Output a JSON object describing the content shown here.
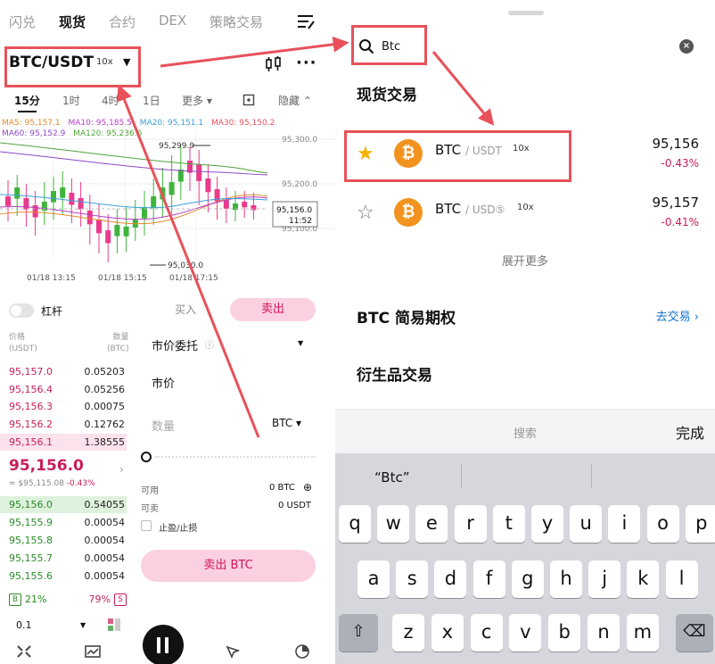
{
  "left": {
    "top_tabs": [
      "闪兑",
      "现货",
      "合约",
      "DEX",
      "策略交易"
    ],
    "active_tab": "现货",
    "pair": {
      "name": "BTC/USDT",
      "leverage": "10x"
    },
    "timeframes": [
      "15分",
      "1时",
      "4时",
      "1日",
      "更多 ▾",
      "隐藏 ⌃"
    ],
    "active_timeframe": "15分",
    "ma_line1": [
      {
        "label": "MA5: 95,157.1",
        "color": "#e58a2a"
      },
      {
        "label": "MA10: 95,185.5",
        "color": "#b43ec0"
      },
      {
        "label": "MA20: 95,151.1",
        "color": "#3aa0d8"
      },
      {
        "label": "MA30: 95,150.2",
        "color": "#e8515a"
      }
    ],
    "ma_line2": [
      {
        "label": "MA60: 95,152.9",
        "color": "#8e47c6"
      },
      {
        "label": "MA120: 95,236.6",
        "color": "#50a23a"
      }
    ],
    "chart": {
      "price_axis": [
        "95,300.0",
        "95,200.0",
        "95,100.0"
      ],
      "current_price_tag": "95,156.0",
      "countdown": "11:52",
      "high_label": "95,299.9",
      "low_label": "95,030.0",
      "time_axis": [
        "01/18 13:15",
        "01/18 15:15",
        "01/18 17:15"
      ]
    },
    "leverage_label": "杠杆",
    "buy_label": "买入",
    "sell_label": "卖出",
    "orderbook": {
      "price_header": [
        "价格",
        "(USDT)"
      ],
      "qty_header": [
        "数量",
        "(BTC)"
      ],
      "asks": [
        {
          "price": "95,157.0",
          "qty": "0.05203"
        },
        {
          "price": "95,156.4",
          "qty": "0.05256"
        },
        {
          "price": "95,156.3",
          "qty": "0.00075"
        },
        {
          "price": "95,156.2",
          "qty": "0.12762"
        },
        {
          "price": "95,156.1",
          "qty": "1.38555"
        }
      ],
      "last_price": "95,156.0",
      "last_sub": "≈ $95,115.08",
      "last_change": "-0.43%",
      "bids": [
        {
          "price": "95,156.0",
          "qty": "0.54055"
        },
        {
          "price": "95,155.9",
          "qty": "0.00054"
        },
        {
          "price": "95,155.8",
          "qty": "0.00054"
        },
        {
          "price": "95,155.7",
          "qty": "0.00054"
        },
        {
          "price": "95,155.6",
          "qty": "0.00054"
        }
      ],
      "buy_badge": "B",
      "buy_ratio": "21%",
      "sell_ratio": "79%",
      "sell_badge": "S",
      "decimal": "0.1"
    },
    "order_form": {
      "order_type": "市价委托",
      "price_label": "市价",
      "qty_placeholder": "数量",
      "qty_unit": "BTC ▾",
      "avail_label": "可用",
      "avail_value": "0 BTC",
      "sellable_label": "可卖",
      "sellable_value": "0 USDT",
      "tpsl_label": "止盈/止损",
      "submit_label": "卖出 BTC"
    }
  },
  "right": {
    "search_value": "Btc",
    "spot_title": "现货交易",
    "results": [
      {
        "symbol": "BTC",
        "quote": "/ USDT",
        "leverage": "10x",
        "price": "95,156",
        "change": "-0.43%",
        "favorite": true
      },
      {
        "symbol": "BTC",
        "quote": "/ USD⑤",
        "leverage": "10x",
        "price": "95,157",
        "change": "-0.41%",
        "favorite": false
      }
    ],
    "expand_more": "展开更多",
    "options_title": "BTC 简易期权",
    "go_trade": "去交易 ›",
    "derivatives_title": "衍生品交易",
    "toolbar_center": "搜索",
    "toolbar_done": "完成",
    "keyboard": {
      "suggestion": "“Btc”",
      "row1": [
        "q",
        "w",
        "e",
        "r",
        "t",
        "y",
        "u",
        "i",
        "o",
        "p"
      ],
      "row2": [
        "a",
        "s",
        "d",
        "f",
        "g",
        "h",
        "j",
        "k",
        "l"
      ],
      "row3": [
        "z",
        "x",
        "c",
        "v",
        "b",
        "n",
        "m"
      ]
    }
  },
  "colors": {
    "sell_red": "#c81d5a",
    "buy_green": "#2a8a26",
    "sell_pink_bg": "#fbd1e2",
    "annotation_red": "#e8515a",
    "btc_orange": "#f2931f",
    "link_blue": "#1676d2"
  }
}
